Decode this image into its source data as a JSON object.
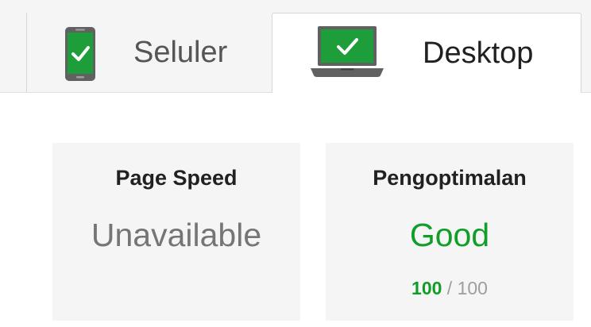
{
  "tabs": {
    "mobile": {
      "label": "Seluler",
      "icon": "mobile-phone-check-icon"
    },
    "desktop": {
      "label": "Desktop",
      "icon": "laptop-check-icon",
      "selected": true
    }
  },
  "cards": {
    "page_speed": {
      "title": "Page Speed",
      "value": "Unavailable"
    },
    "optimization": {
      "title": "Pengoptimalan",
      "value": "Good",
      "score": "100",
      "separator": "/",
      "max": "100"
    }
  },
  "colors": {
    "good_green": "#109d28",
    "icon_green": "#1e9e3a",
    "device_gray": "#616161",
    "card_bg": "#f5f5f5"
  }
}
